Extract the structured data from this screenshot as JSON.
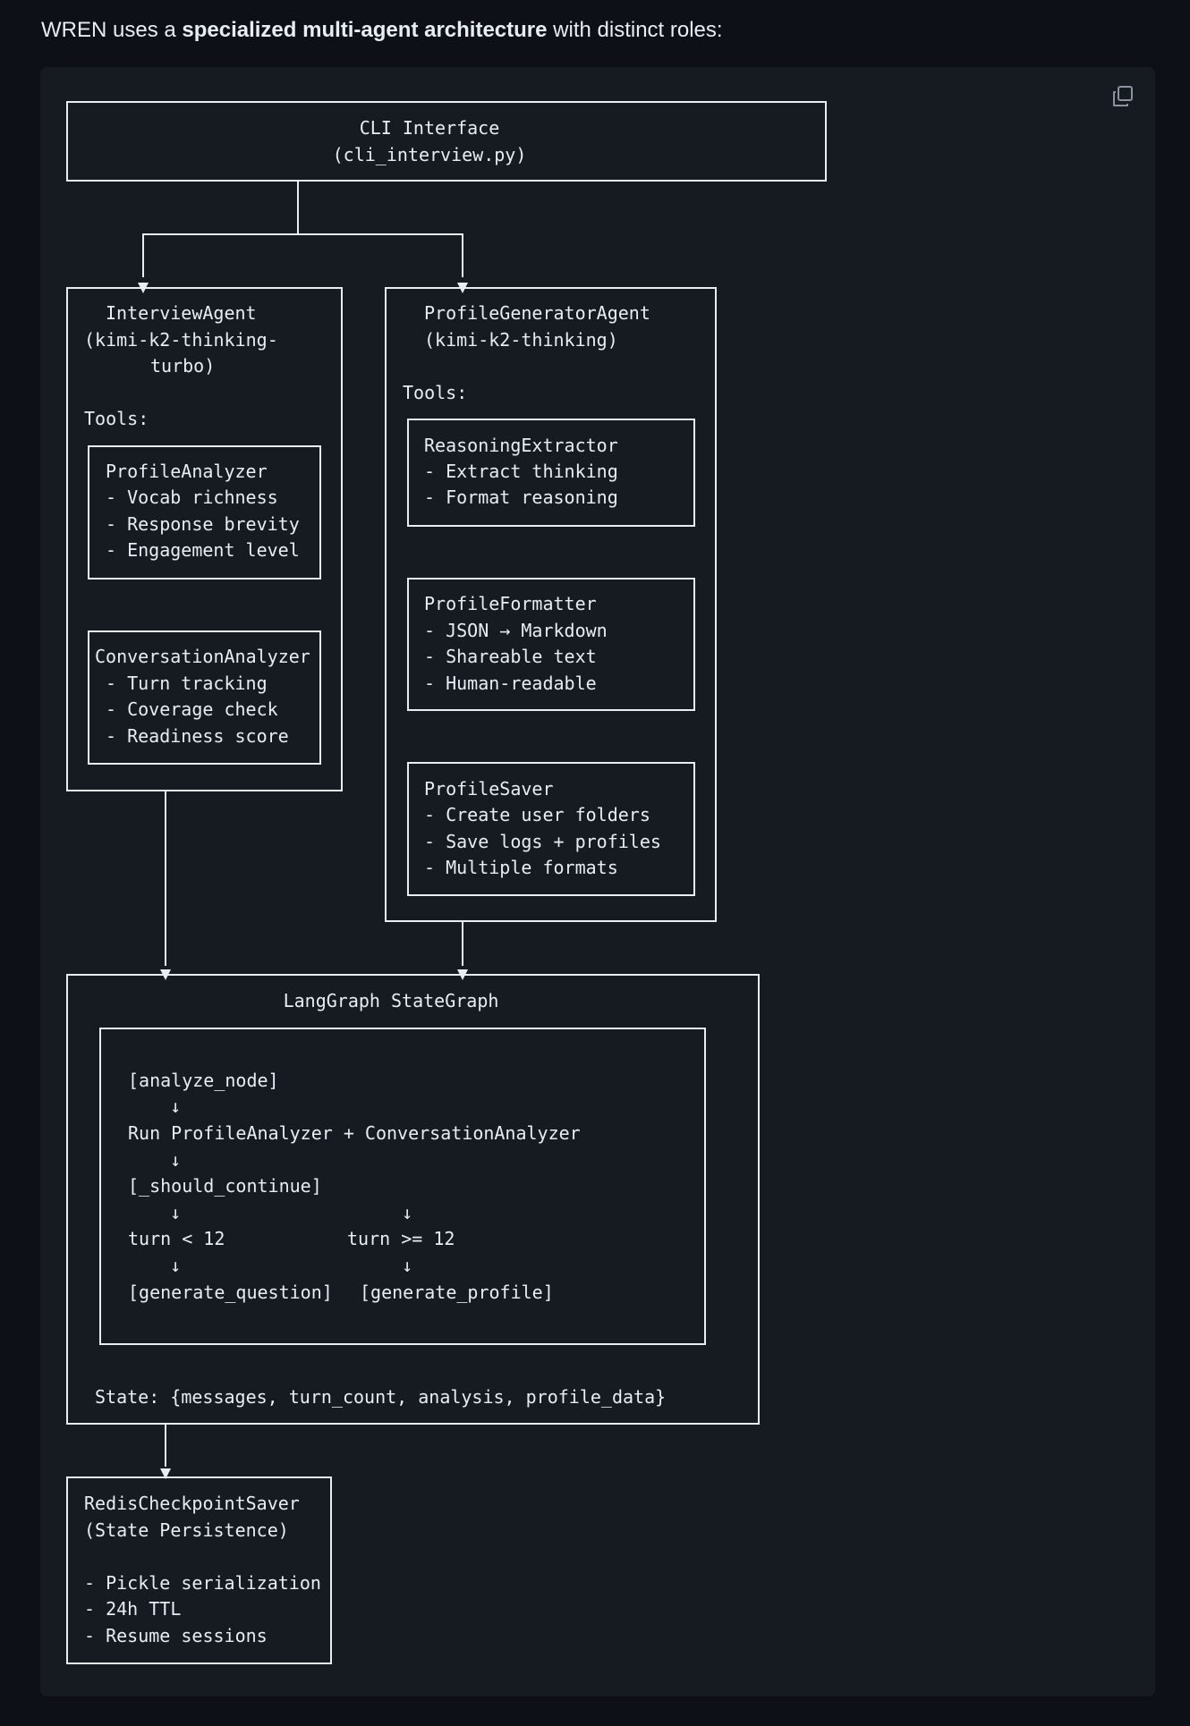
{
  "intro": {
    "prefix": "WREN uses a ",
    "bold": "specialized multi-agent architecture",
    "suffix": " with distinct roles:"
  },
  "code_block": {
    "copy_icon": "copy-icon"
  },
  "diagram": {
    "cli": {
      "title": "CLI Interface",
      "subtitle": "(cli_interview.py)"
    },
    "interview_agent": {
      "title": "InterviewAgent",
      "model_line1": "(kimi-k2-thinking-",
      "model_line2": "turbo)",
      "tools_label": "Tools:",
      "profile_analyzer": {
        "title": "ProfileAnalyzer",
        "items": [
          "- Vocab richness",
          "- Response brevity",
          "- Engagement level"
        ]
      },
      "conversation_analyzer": {
        "title": "ConversationAnalyzer",
        "items": [
          "- Turn tracking",
          "- Coverage check",
          "- Readiness score"
        ]
      }
    },
    "profile_generator": {
      "title": "ProfileGeneratorAgent",
      "model": "(kimi-k2-thinking)",
      "tools_label": "Tools:",
      "reasoning_extractor": {
        "title": "ReasoningExtractor",
        "items": [
          "- Extract thinking",
          "- Format reasoning"
        ]
      },
      "profile_formatter": {
        "title": "ProfileFormatter",
        "items": [
          "- JSON → Markdown",
          "- Shareable text",
          "- Human-readable"
        ]
      },
      "profile_saver": {
        "title": "ProfileSaver",
        "items": [
          "- Create user folders",
          "- Save logs + profiles",
          "- Multiple formats"
        ]
      }
    },
    "langgraph": {
      "title": "LangGraph StateGraph",
      "analyze_node": "[analyze_node]",
      "run_line": "Run ProfileAnalyzer + ConversationAnalyzer",
      "should_continue": "[_should_continue]",
      "turn_lt": "turn < 12",
      "turn_ge": "turn >= 12",
      "generate_question": "[generate_question]",
      "generate_profile": "[generate_profile]",
      "arrow": "↓",
      "state": "State: {messages, turn_count, analysis, profile_data}"
    },
    "redis": {
      "title": "RedisCheckpointSaver",
      "subtitle": "(State Persistence)",
      "items": [
        "- Pickle serialization",
        "- 24h TTL",
        "- Resume sessions"
      ]
    }
  }
}
